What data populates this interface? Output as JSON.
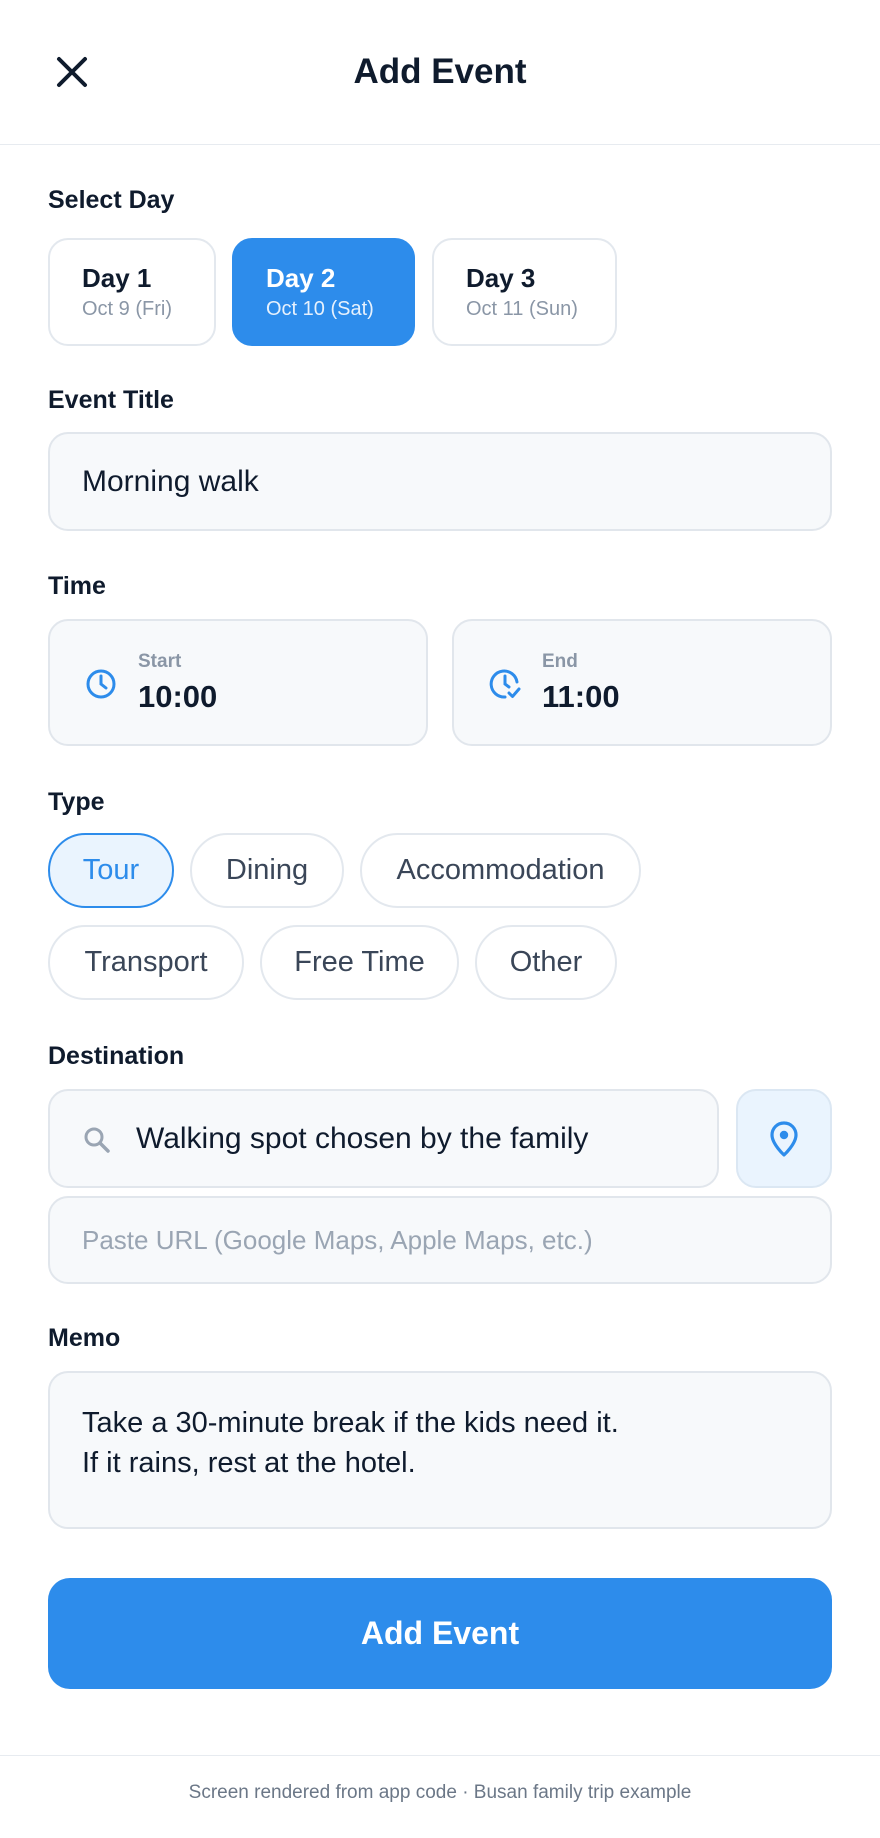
{
  "header": {
    "title": "Add Event"
  },
  "days": {
    "label": "Select Day",
    "items": [
      {
        "name": "Day 1",
        "date": "Oct 9 (Fri)",
        "selected": false
      },
      {
        "name": "Day 2",
        "date": "Oct 10 (Sat)",
        "selected": true
      },
      {
        "name": "Day 3",
        "date": "Oct 11 (Sun)",
        "selected": false
      }
    ]
  },
  "event_title": {
    "label": "Event Title",
    "value": "Morning walk"
  },
  "time": {
    "label": "Time",
    "start_label": "Start",
    "start_value": "10:00",
    "end_label": "End",
    "end_value": "11:00"
  },
  "type": {
    "label": "Type",
    "options": [
      "Tour",
      "Dining",
      "Accommodation",
      "Transport",
      "Free Time",
      "Other"
    ],
    "selected": "Tour"
  },
  "destination": {
    "label": "Destination",
    "value": "Walking spot chosen by the family",
    "url_placeholder": "Paste URL (Google Maps, Apple Maps, etc.)"
  },
  "memo": {
    "label": "Memo",
    "line1": "Take a 30-minute break if the kids need it.",
    "line2": "If it rains, rest at the hotel."
  },
  "submit_label": "Add Event",
  "footer": {
    "note": "Screen rendered from app code · Busan family trip example"
  },
  "colors": {
    "accent": "#2d8ceb",
    "accent_soft": "#eaf4fe",
    "text": "#0f1b2d",
    "muted": "#8a96a6"
  }
}
